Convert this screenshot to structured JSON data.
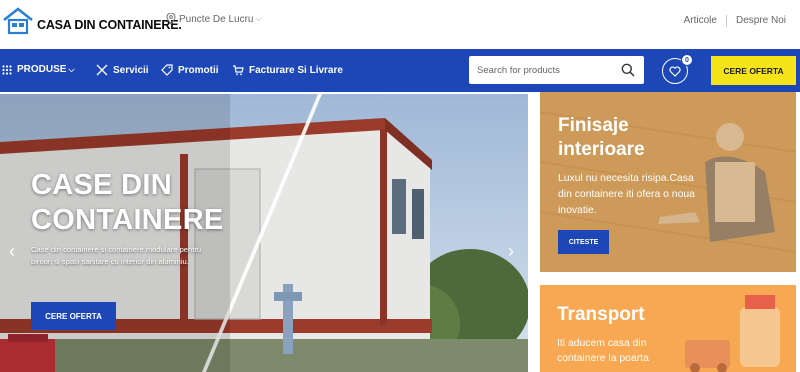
{
  "header": {
    "logo_text": "CASA DIN CONTAINERE.",
    "location_label": "Puncte De Lucru",
    "links": [
      "Articole",
      "Despre Noi"
    ]
  },
  "nav": {
    "products_label": "PRODUSE",
    "items": [
      "Servicii",
      "Promotii",
      "Facturare Si Livrare"
    ],
    "search_placeholder": "Search for products",
    "wishlist_count": "0",
    "cta_label": "CERE OFERTA"
  },
  "hero": {
    "title_line1": "CASE DIN",
    "title_line2": "CONTAINERE",
    "description": "Case din containere si containere modulare pentru birouri si spatii sanitare cu interior din aluminiu.",
    "button_label": "CERE OFERTA",
    "prev_arrow": "‹",
    "next_arrow": "›"
  },
  "cards": {
    "finisaje": {
      "title": "Finisaje interioare",
      "description": "Luxul nu necesita risipa.Casa din containere iti ofera o noua inovatie.",
      "button_label": "CITESTE"
    },
    "transport": {
      "title": "Transport",
      "description": "Iti aducem casa din containere la poarta"
    }
  },
  "colors": {
    "primary": "#1d47b6",
    "accent": "#f6e41b",
    "card_wood": "#d9b07a",
    "card_orange": "#f8a853"
  }
}
